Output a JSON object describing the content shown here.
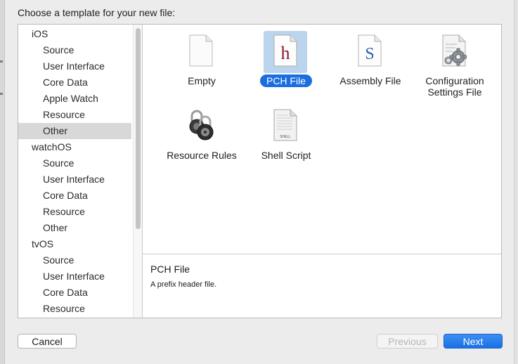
{
  "dialog": {
    "prompt": "Choose a template for your new file:"
  },
  "sidebar": {
    "items": [
      {
        "label": "iOS",
        "kind": "platform"
      },
      {
        "label": "Source",
        "kind": "category"
      },
      {
        "label": "User Interface",
        "kind": "category"
      },
      {
        "label": "Core Data",
        "kind": "category"
      },
      {
        "label": "Apple Watch",
        "kind": "category"
      },
      {
        "label": "Resource",
        "kind": "category"
      },
      {
        "label": "Other",
        "kind": "category",
        "selected": true
      },
      {
        "label": "watchOS",
        "kind": "platform"
      },
      {
        "label": "Source",
        "kind": "category"
      },
      {
        "label": "User Interface",
        "kind": "category"
      },
      {
        "label": "Core Data",
        "kind": "category"
      },
      {
        "label": "Resource",
        "kind": "category"
      },
      {
        "label": "Other",
        "kind": "category"
      },
      {
        "label": "tvOS",
        "kind": "platform"
      },
      {
        "label": "Source",
        "kind": "category"
      },
      {
        "label": "User Interface",
        "kind": "category"
      },
      {
        "label": "Core Data",
        "kind": "category"
      },
      {
        "label": "Resource",
        "kind": "category"
      }
    ]
  },
  "templates": [
    {
      "label": "Empty",
      "icon": "empty-document-icon"
    },
    {
      "label": "PCH File",
      "icon": "pch-file-icon",
      "glyph": "h",
      "selected": true
    },
    {
      "label": "Assembly File",
      "icon": "assembly-file-icon",
      "glyph": "S"
    },
    {
      "label": "Configuration Settings File",
      "line1": "Configuration",
      "line2": "Settings File",
      "icon": "configuration-settings-icon"
    },
    {
      "label": "Resource Rules",
      "icon": "padlocks-icon"
    },
    {
      "label": "Shell Script",
      "icon": "shell-script-icon",
      "badge": "SHELL"
    }
  ],
  "description": {
    "title": "PCH File",
    "text": "A prefix header file."
  },
  "buttons": {
    "cancel": "Cancel",
    "previous": "Previous",
    "next": "Next"
  },
  "colors": {
    "accent": "#1b6ee0",
    "selection_tile": "#bcd5ef",
    "sidebar_selected": "#d8d8d8",
    "pch_glyph": "#8b1a2a",
    "assembly_glyph": "#2c63b0"
  }
}
